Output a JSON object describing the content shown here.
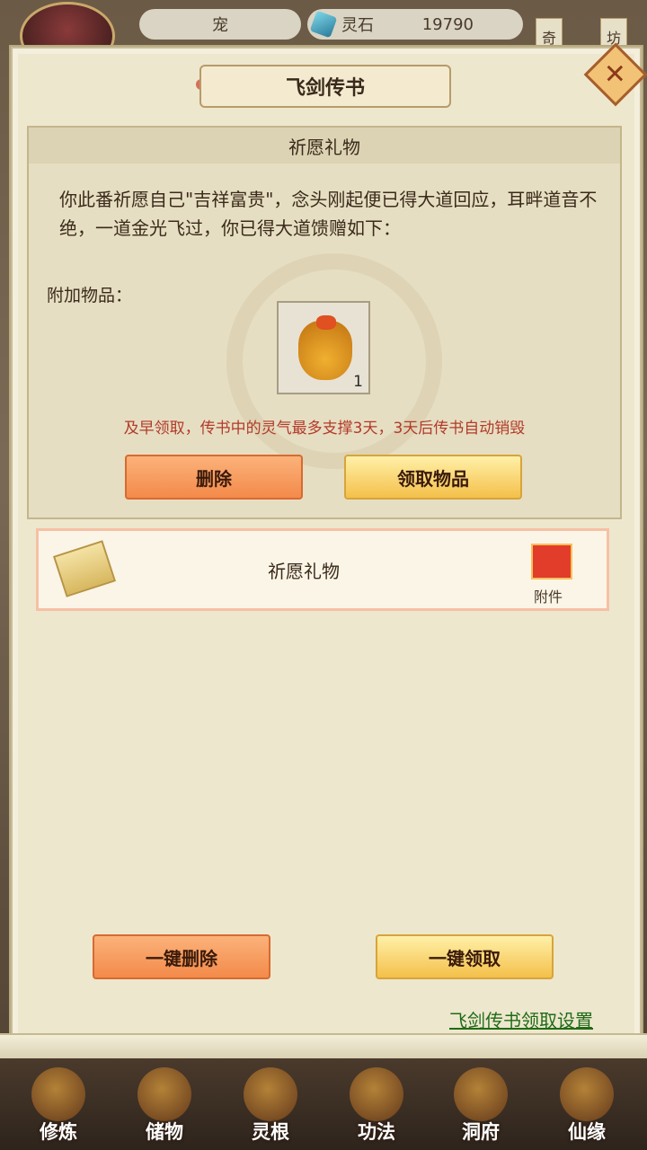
{
  "topbar": {
    "pet_label": "宠",
    "stone_label": "灵石",
    "stone_value": "19790",
    "side_tab_1": "奇",
    "side_tab_2": "坊"
  },
  "dialog": {
    "title": "飞剑传书",
    "close_label": "✕"
  },
  "detail": {
    "header": "祈愿礼物",
    "body": "你此番祈愿自己\"吉祥富贵\"，念头刚起便已得大道回应，耳畔道音不绝，一道金光飞过，你已得大道馈赠如下：",
    "attach_label": "附加物品：",
    "item_count": "1",
    "warning": "及早领取，传书中的灵气最多支撑3天，3天后传书自动销毁",
    "delete_label": "删除",
    "claim_label": "领取物品"
  },
  "mail_list": [
    {
      "title": "祈愿礼物",
      "attach_caption": "附件"
    }
  ],
  "actions": {
    "delete_all_label": "一键删除",
    "claim_all_label": "一键领取",
    "settings_link": "飞剑传书领取设置"
  },
  "bottom_nav": [
    {
      "label": "修炼",
      "icon": "cultivate-icon"
    },
    {
      "label": "储物",
      "icon": "storage-icon"
    },
    {
      "label": "灵根",
      "icon": "spirit-root-icon"
    },
    {
      "label": "功法",
      "icon": "technique-icon"
    },
    {
      "label": "洞府",
      "icon": "cave-icon"
    },
    {
      "label": "仙缘",
      "icon": "immortal-fate-icon"
    }
  ],
  "colors": {
    "panel": "#ede7ce",
    "warning": "#b23a2a",
    "link": "#1f6b16",
    "orange_button": "#f38a4a",
    "gold_button": "#f4c04a"
  }
}
